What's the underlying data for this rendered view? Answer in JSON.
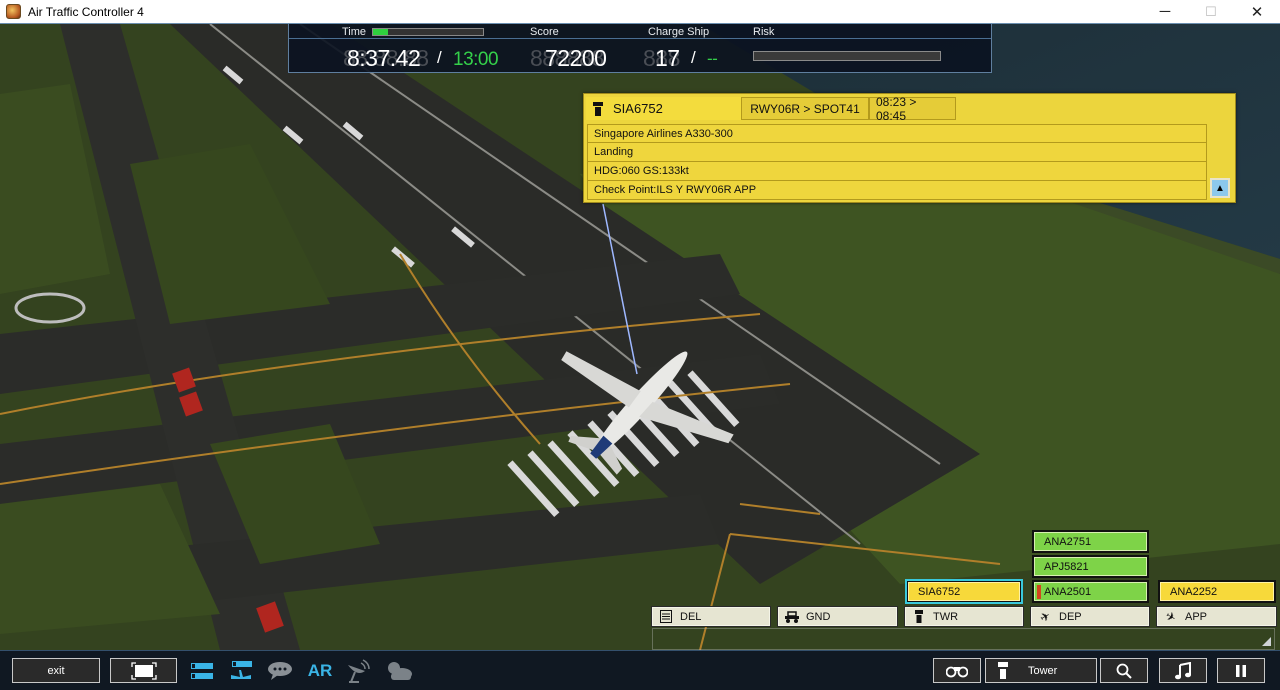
{
  "window": {
    "title": "Air Traffic Controller 4",
    "app_icon": "atc4-app-icon",
    "controls": {
      "minimize": "─",
      "maximize": "☐",
      "close": "✕"
    }
  },
  "hud": {
    "time_label": "Time",
    "time_progress_fraction": 0.14,
    "time_current": "8:37.42",
    "time_current_ghost": "88:88.88",
    "time_separator": "/",
    "time_limit": "13:00",
    "score_label": "Score",
    "score_value": "72200",
    "score_ghost": "888888",
    "charge_ship_label": "Charge Ship",
    "charge_ship_value": "17",
    "charge_ship_ghost": "888",
    "charge_ship_separator": "/",
    "charge_ship_limit": "--",
    "risk_label": "Risk",
    "risk_fraction": 0.0
  },
  "flight_info": {
    "callsign": "SIA6752",
    "controller_icon": "tower-icon",
    "route": "RWY06R > SPOT41",
    "times": "08:23 > 08:45",
    "rows": [
      "Singapore Airlines A330-300",
      "Landing",
      "HDG:060 GS:133kt",
      "Check Point:ILS Y RWY06R APP"
    ],
    "collapse_glyph": "▲"
  },
  "strips": {
    "twr": [
      {
        "callsign": "SIA6752",
        "color": "yellow",
        "selected": true
      }
    ],
    "dep": [
      {
        "callsign": "ANA2751",
        "color": "green"
      },
      {
        "callsign": "APJ5821",
        "color": "green"
      },
      {
        "callsign": "ANA2501",
        "color": "green",
        "flag": true
      }
    ],
    "app": [
      {
        "callsign": "ANA2252",
        "color": "yellow"
      }
    ]
  },
  "tabs": [
    {
      "id": "del",
      "label": "DEL",
      "icon": "clipboard-icon"
    },
    {
      "id": "gnd",
      "label": "GND",
      "icon": "ground-vehicle-icon"
    },
    {
      "id": "twr",
      "label": "TWR",
      "icon": "tower-icon"
    },
    {
      "id": "dep",
      "label": "DEP",
      "icon": "departure-plane-icon"
    },
    {
      "id": "app",
      "label": "APP",
      "icon": "arrival-plane-icon"
    }
  ],
  "toolbar": {
    "exit_label": "exit",
    "ar_label": "AR",
    "view_label": "Tower"
  },
  "colors": {
    "strip_green": "#7ed348",
    "strip_yellow": "#f7d93a",
    "panel_yellow": "#ecd53d",
    "accent_cyan": "#39c9dc",
    "icon_blue": "#3ab4e6",
    "time_green": "#34d04a"
  }
}
